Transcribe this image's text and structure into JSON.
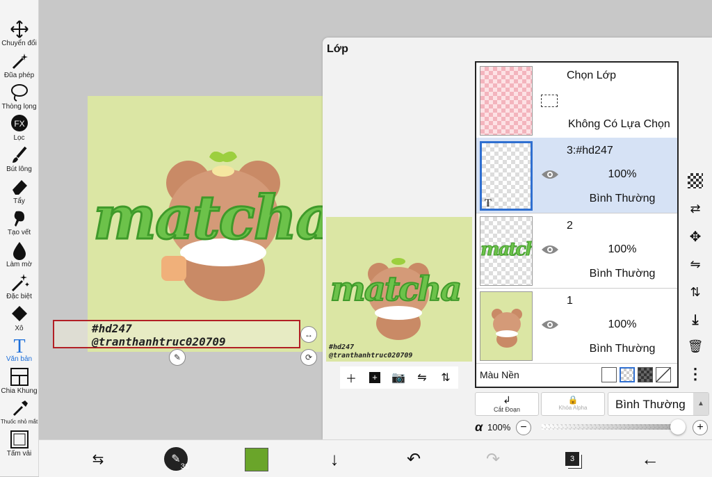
{
  "toolbar": {
    "tools": [
      {
        "label": "Chuyển đổi",
        "icon": "move-icon"
      },
      {
        "label": "Đũa phép",
        "icon": "magic-wand-icon"
      },
      {
        "label": "Thòng lọng",
        "icon": "lasso-icon"
      },
      {
        "label": "Lọc",
        "icon": "fx-filter-icon"
      },
      {
        "label": "Bút lông",
        "icon": "brush-icon"
      },
      {
        "label": "Tẩy",
        "icon": "eraser-icon"
      },
      {
        "label": "Tạo vết",
        "icon": "smudge-icon"
      },
      {
        "label": "Làm mờ",
        "icon": "blur-drop-icon"
      },
      {
        "label": "Đặc biệt",
        "icon": "special-sparkle-icon"
      },
      {
        "label": "Xô",
        "icon": "bucket-icon"
      },
      {
        "label": "Văn bản",
        "icon": "text-tool-icon",
        "active": true
      },
      {
        "label": "Chia Khung",
        "icon": "frame-divider-icon"
      },
      {
        "label": "Thuốc nhỏ mắt",
        "icon": "eyedropper-icon"
      },
      {
        "label": "Tấm vải",
        "icon": "canvas-icon"
      }
    ]
  },
  "canvas": {
    "artwork_word": "matcha",
    "text_layer": {
      "line1": "#hd247",
      "line2": "@tranthanhtruc020709"
    }
  },
  "preview": {
    "artwork_word": "matcha",
    "line1": "#hd247",
    "line2": "@tranthanhtruc020709"
  },
  "panel": {
    "title": "Lớp",
    "selection_layer": {
      "title": "Chọn Lớp",
      "status": "Không Có Lựa Chọn"
    },
    "layers": [
      {
        "name": "3:#hd247",
        "opacity": "100%",
        "mode": "Bình Thường",
        "selected": true,
        "thumb_mark": "T"
      },
      {
        "name": "2",
        "opacity": "100%",
        "mode": "Bình Thường",
        "selected": false
      },
      {
        "name": "1",
        "opacity": "100%",
        "mode": "Bình Thường",
        "selected": false
      }
    ],
    "background_label": "Màu Nền",
    "clipping_label": "Cắt Đoạn",
    "alpha_lock_label": "Khóa Alpha",
    "blend_mode": "Bình Thường",
    "alpha_symbol": "α",
    "alpha_value": "100%",
    "alpha_fraction": 1.0
  },
  "bottombar": {
    "brush_size": "36",
    "color": "#6aa52a",
    "layer_count": "3"
  },
  "colors": {
    "accent": "#1e6fd9",
    "selected_layer_bg": "#d6e2f5",
    "canvas_bg": "#dbe6a4",
    "text_box_border": "#b21f24"
  }
}
